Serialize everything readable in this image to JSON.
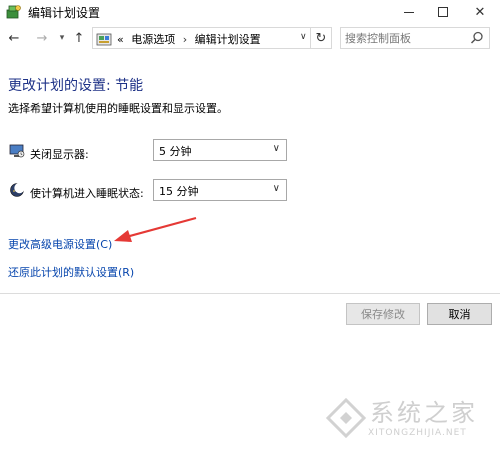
{
  "window": {
    "title": "编辑计划设置"
  },
  "nav": {
    "breadcrumb": [
      "电源选项",
      "编辑计划设置"
    ],
    "breadcrumb_prefix": "«",
    "search_placeholder": "搜索控制面板"
  },
  "content": {
    "title": "更改计划的设置: 节能",
    "description": "选择希望计算机使用的睡眠设置和显示设置。",
    "settings": [
      {
        "label": "关闭显示器:",
        "value": "5 分钟",
        "icon": "monitor-icon"
      },
      {
        "label": "使计算机进入睡眠状态:",
        "value": "15 分钟",
        "icon": "moon-icon"
      }
    ],
    "links": {
      "advanced": "更改高级电源设置(C)",
      "restore": "还原此计划的默认设置(R)"
    }
  },
  "buttons": {
    "save": "保存修改",
    "cancel": "取消"
  },
  "watermark": {
    "text": "系统之家",
    "sub": "XITONGZHIJIA.NET"
  },
  "colors": {
    "title": "#1e3287",
    "link": "#0645ad",
    "annotation": "#e53935"
  }
}
